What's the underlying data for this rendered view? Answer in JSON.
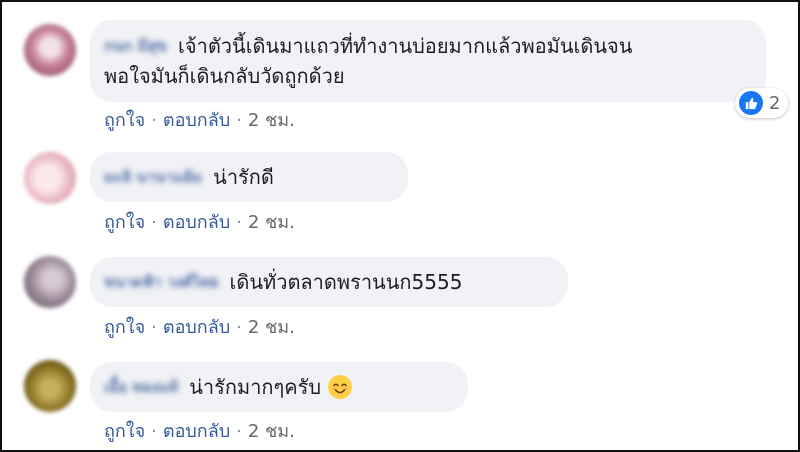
{
  "comments": [
    {
      "author": "กนก มีสุข",
      "text_line1": "เจ้าตัวนี้เดินมาแถวที่ทำงานบ่อยมากแล้วพอมันเดินจน",
      "text_line2": "พอใจมันก็เดินกลับวัดถูกด้วย",
      "like_label": "ถูกใจ",
      "reply_label": "ตอบกลับ",
      "time": "2 ชม.",
      "reaction_count": "2",
      "avatar_color": "#c9859a"
    },
    {
      "author": "มะลิ นานาแย้ม",
      "text": "น่ารักดี",
      "like_label": "ถูกใจ",
      "reply_label": "ตอบกลับ",
      "time": "2 ชม.",
      "avatar_color": "#e7b5bf"
    },
    {
      "author": "ขนาดฟ้า วงศ์ไทย",
      "text": "เดินทั่วตลาดพรานนก5555",
      "like_label": "ถูกใจ",
      "reply_label": "ตอบกลับ",
      "time": "2 ชม.",
      "avatar_color": "#9f8e9c"
    },
    {
      "author": "เอื้อ ทองแท้",
      "text": "น่ารักมากๆครับ",
      "emoji": "smiling-face",
      "like_label": "ถูกใจ",
      "reply_label": "ตอบกลับ",
      "time": "2 ชม.",
      "avatar_color": "#8a7322"
    }
  ],
  "colors": {
    "bubble": "#f0f2f5",
    "link": "#385898",
    "like_blue": "#1877f2"
  }
}
